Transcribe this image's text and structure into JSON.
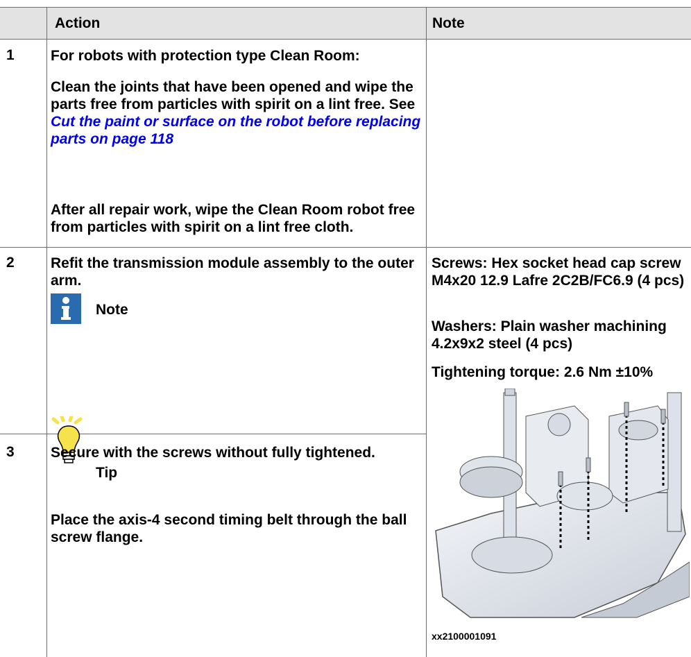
{
  "table": {
    "headers": {
      "action": "Action",
      "note": "Note"
    },
    "rows": [
      {
        "num": "1",
        "action_title": "For robots with protection type Clean Room:",
        "action_text": "Clean the joints that have been opened and wipe the parts free from particles with spirit on a lint free. See",
        "action_link": "Cut the paint or surface on the robot before replacing parts on page 118",
        "note_label": "Note",
        "note_text": "After all repair work, wipe the Clean Room robot free from particles with spirit on a lint free cloth."
      },
      {
        "num": "2",
        "action_text": "Refit the transmission module assembly to the outer arm.",
        "tip_label": "Tip",
        "tip_text": "Place the axis-4 second timing belt through the ball screw flange.",
        "note_lines": [
          "Screws: Hex socket head cap screw M4x20 12.9 Lafre 2C2B/FC6.9 (4 pcs)",
          "Washers: Plain washer machining 4.2x9x2  steel (4 pcs)",
          "Tightening torque: 2.6 Nm ±10%"
        ]
      },
      {
        "num": "3",
        "action_text": "Secure with the screws without fully tightened."
      }
    ],
    "figure_caption": "xx2100001091"
  },
  "colors": {
    "header_bg": "#e3e3e3",
    "note_icon": "#2a6bb0",
    "tip_icon": "#f6e34b",
    "link": "#0000ee"
  },
  "icons": [
    "info-icon",
    "lightbulb-icon"
  ]
}
